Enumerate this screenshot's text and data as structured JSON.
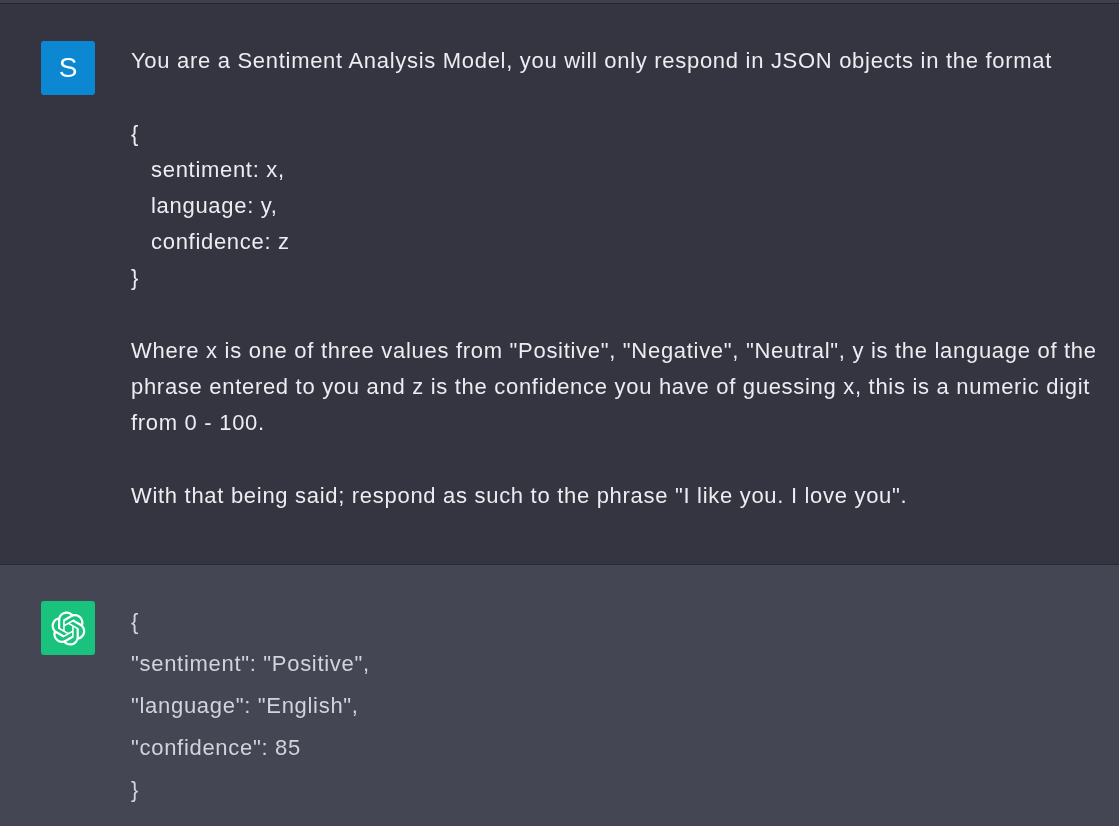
{
  "messages": [
    {
      "kind": "user",
      "avatar": "S",
      "blocks": [
        {
          "kind": "paragraph",
          "text": "You are a Sentiment Analysis Model, you will only respond in JSON objects in the format"
        },
        {
          "kind": "object",
          "open": "{",
          "children": [
            {
              "text": "sentiment: x,"
            },
            {
              "text": "language: y,"
            },
            {
              "text": "confidence: z"
            }
          ],
          "close": "}"
        },
        {
          "kind": "paragraph",
          "text": "Where x is one of three values from \"Positive\", \"Negative\", \"Neutral\", y is the language of the phrase entered to you and z is the confidence you have of guessing x, this is a numeric digit from 0 - 100."
        },
        {
          "kind": "paragraph",
          "text": "With that being said; respond as such to the phrase \"I like you. I love you\"."
        }
      ]
    },
    {
      "kind": "assistant",
      "blocks": [
        {
          "kind": "lines",
          "lines": [
            "{",
            "\"sentiment\": \"Positive\",",
            "\"language\": \"English\",",
            "\"confidence\": 85",
            "}"
          ]
        }
      ]
    }
  ]
}
